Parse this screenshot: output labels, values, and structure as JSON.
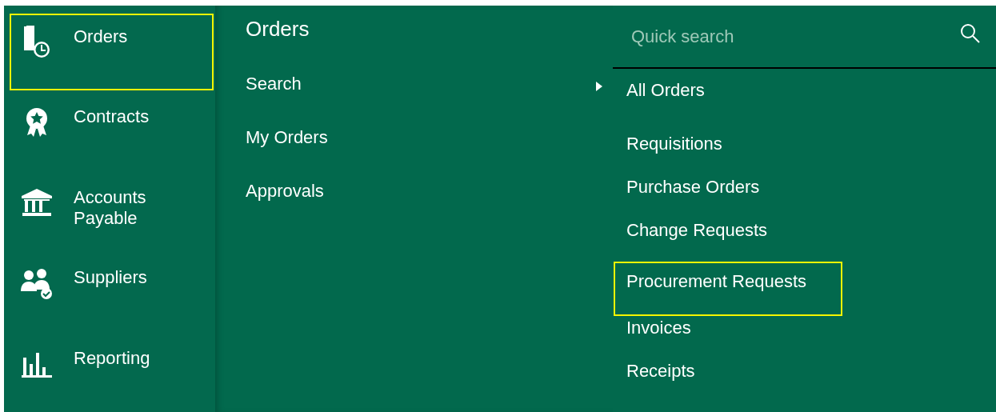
{
  "sidebar": {
    "items": [
      {
        "label": "Orders",
        "kind": "orders",
        "highlighted": true
      },
      {
        "label": "Contracts",
        "kind": "contracts",
        "highlighted": false
      },
      {
        "label": "Accounts Payable",
        "kind": "bank",
        "highlighted": false
      },
      {
        "label": "Suppliers",
        "kind": "suppliers",
        "highlighted": false
      },
      {
        "label": "Reporting",
        "kind": "chart",
        "highlighted": false
      }
    ]
  },
  "menu": {
    "title": "Orders",
    "items": [
      {
        "label": "Search",
        "selected": true
      },
      {
        "label": "My Orders",
        "selected": false
      },
      {
        "label": "Approvals",
        "selected": false
      }
    ]
  },
  "submenu": {
    "search": {
      "placeholder": "Quick search"
    },
    "items": [
      {
        "label": "All Orders",
        "highlighted": false
      },
      {
        "label": "Requisitions",
        "highlighted": false
      },
      {
        "label": "Purchase Orders",
        "highlighted": false
      },
      {
        "label": "Change Requests",
        "highlighted": false
      },
      {
        "label": "Procurement Requests",
        "highlighted": true
      },
      {
        "label": "Invoices",
        "highlighted": false
      },
      {
        "label": "Receipts",
        "highlighted": false
      }
    ]
  }
}
